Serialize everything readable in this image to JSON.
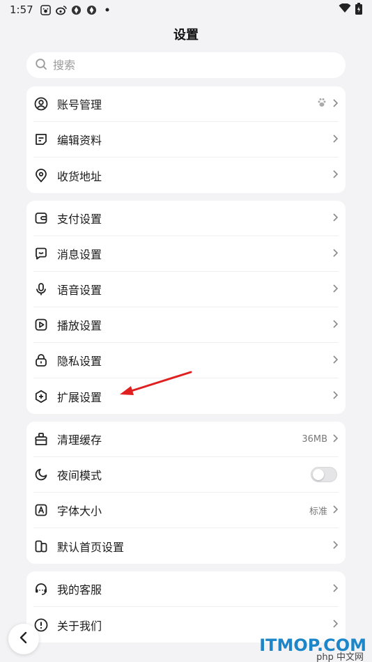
{
  "status_bar": {
    "time": "1:57",
    "icons": [
      "baidu-icon",
      "weibo-icon",
      "app-icon",
      "app-icon",
      "dot-icon"
    ],
    "right_icons": [
      "wifi-icon",
      "battery-icon"
    ]
  },
  "header": {
    "title": "设置"
  },
  "search": {
    "placeholder": "搜索"
  },
  "groups": [
    {
      "items": [
        {
          "label": "账号管理",
          "icon": "user-icon"
        },
        {
          "label": "编辑资料",
          "icon": "edit-icon"
        },
        {
          "label": "收货地址",
          "icon": "location-icon"
        }
      ]
    },
    {
      "items": [
        {
          "label": "支付设置",
          "icon": "wallet-icon"
        },
        {
          "label": "消息设置",
          "icon": "message-icon"
        },
        {
          "label": "语音设置",
          "icon": "microphone-icon"
        },
        {
          "label": "播放设置",
          "icon": "play-icon"
        },
        {
          "label": "隐私设置",
          "icon": "lock-icon"
        },
        {
          "label": "扩展设置",
          "icon": "extension-icon"
        }
      ]
    },
    {
      "items": [
        {
          "label": "清理缓存",
          "icon": "clean-icon",
          "value": "36MB"
        },
        {
          "label": "夜间模式",
          "icon": "moon-icon",
          "toggle": false
        },
        {
          "label": "字体大小",
          "icon": "font-icon",
          "value": "标准"
        },
        {
          "label": "默认首页设置",
          "icon": "home-icon"
        }
      ]
    },
    {
      "items": [
        {
          "label": "我的客服",
          "icon": "headset-icon"
        },
        {
          "label": "关于我们",
          "icon": "info-icon"
        }
      ]
    }
  ],
  "watermark": {
    "text": "ITMOP.COM",
    "sub": "php 中文网"
  },
  "colors": {
    "background": "#f3f3f5",
    "card": "#ffffff",
    "arrow": "#e02020"
  }
}
